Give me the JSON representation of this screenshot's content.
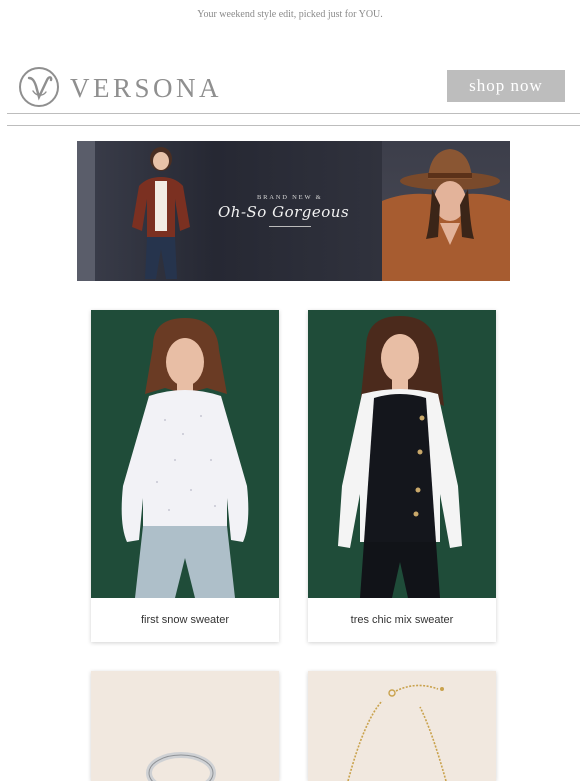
{
  "preheader": "Your weekend style edit, picked just for YOU.",
  "header": {
    "logo_text": "VERSONA",
    "shop_button": "shop now"
  },
  "banner": {
    "small_text": "BRAND NEW &",
    "script_text": "Oh-So Gorgeous"
  },
  "products": [
    {
      "caption": "first snow sweater"
    },
    {
      "caption": "tres chic mix sweater"
    },
    {
      "caption": ""
    },
    {
      "caption": ""
    }
  ],
  "colors": {
    "product_background": "#1f4c39",
    "button_gray": "#bdbdbd",
    "logo_gray": "#8f8f8f"
  }
}
